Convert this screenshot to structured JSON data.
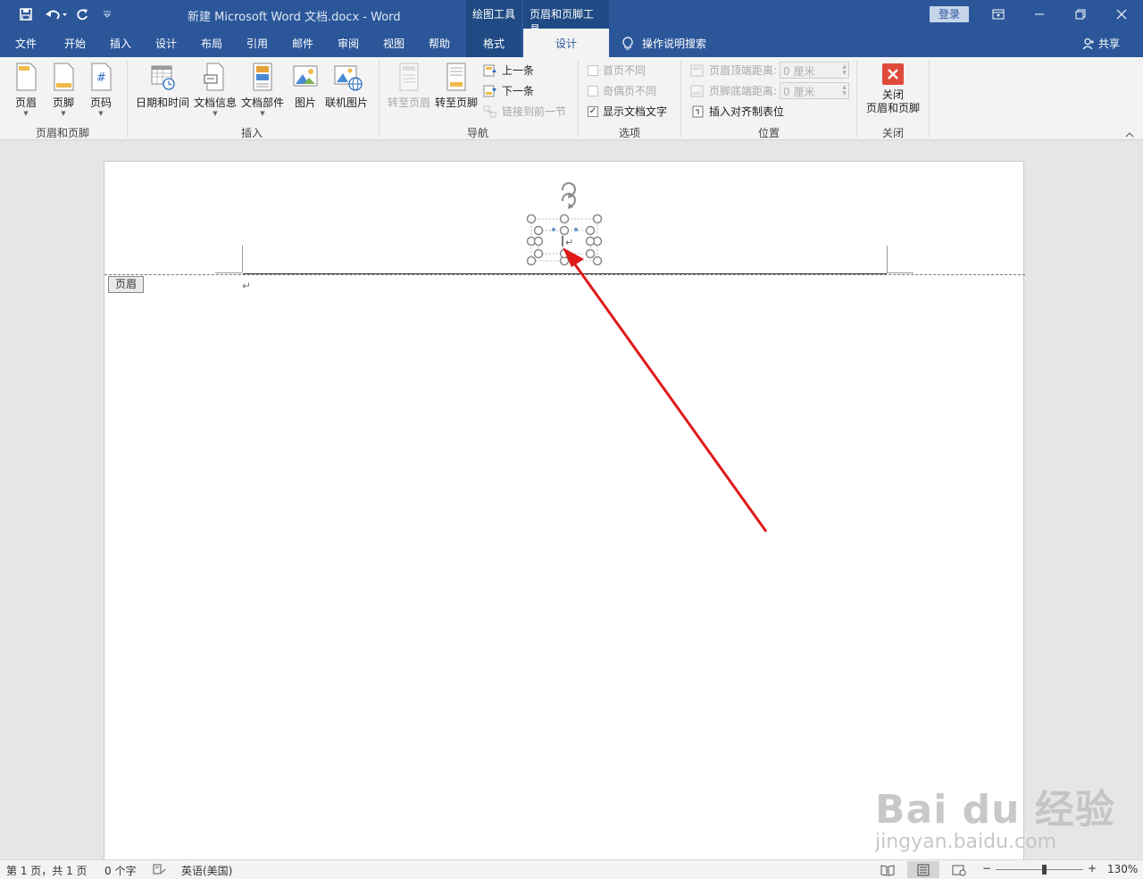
{
  "titlebar": {
    "doc_title": "新建 Microsoft Word 文档.docx  -  Word",
    "ctx_drawing": "绘图工具",
    "ctx_header_footer": "页眉和页脚工具",
    "login": "登录"
  },
  "tabs": {
    "file": "文件",
    "home": "开始",
    "insert": "插入",
    "design": "设计",
    "layout": "布局",
    "references": "引用",
    "mailings": "邮件",
    "review": "审阅",
    "view": "视图",
    "help": "帮助",
    "format": "格式",
    "hf_design": "设计",
    "tell_me": "操作说明搜索",
    "share": "共享"
  },
  "ribbon": {
    "hf_group": {
      "label": "页眉和页脚",
      "header": "页眉",
      "footer": "页脚",
      "page_number": "页码"
    },
    "insert_group": {
      "label": "插入",
      "date_time": "日期和时间",
      "doc_info": "文档信息",
      "quick_parts": "文档部件",
      "pictures": "图片",
      "online_pictures": "联机图片"
    },
    "nav_group": {
      "label": "导航",
      "goto_header": "转至页眉",
      "goto_footer": "转至页脚",
      "previous": "上一条",
      "next": "下一条",
      "link_previous": "链接到前一节"
    },
    "options_group": {
      "label": "选项",
      "different_first": "首页不同",
      "different_odd_even": "奇偶页不同",
      "show_doc_text": "显示文档文字"
    },
    "position_group": {
      "label": "位置",
      "header_from_top": "页眉顶端距离:",
      "header_from_top_value": "0 厘米",
      "footer_from_bottom": "页脚底端距离:",
      "footer_from_bottom_value": "0 厘米",
      "insert_align_tab": "插入对齐制表位"
    },
    "close_group": {
      "label": "关闭",
      "close_line1": "关闭",
      "close_line2": "页眉和页脚"
    }
  },
  "document": {
    "header_tag": "页眉",
    "para_mark": "↵"
  },
  "statusbar": {
    "page": "第 1 页，共 1 页",
    "words": "0 个字",
    "language": "英语(美国)",
    "zoom": "130%",
    "zoom_fraction": 0.55
  },
  "watermark": {
    "main": "Bai du 经验",
    "sub": "jingyan.baidu.com"
  },
  "colors": {
    "accent": "#2b579a",
    "annotation_arrow": "#e01818",
    "close_button": "#e04a3b"
  }
}
